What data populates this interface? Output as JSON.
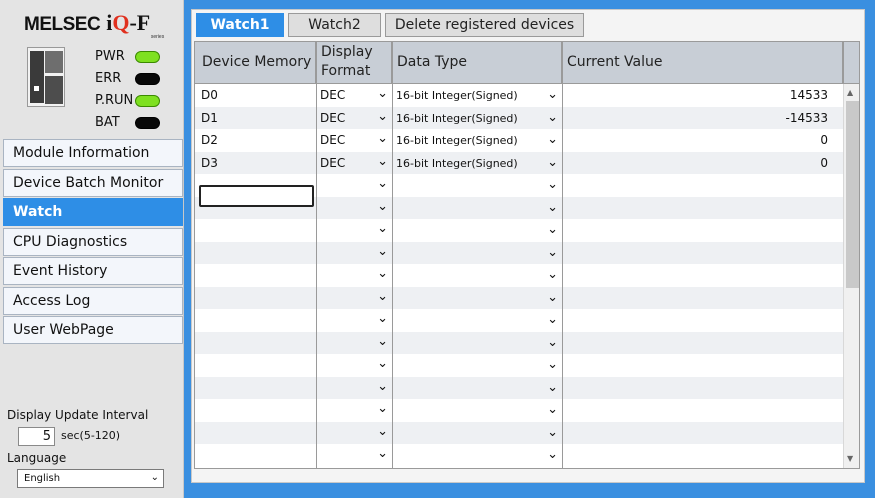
{
  "logo": {
    "brand": "MELSEC",
    "product_i": "i",
    "product_q": "Q",
    "product_dash": "-",
    "product_f": "F",
    "series": "series"
  },
  "status": [
    {
      "label": "PWR",
      "state": "on"
    },
    {
      "label": "ERR",
      "state": "off"
    },
    {
      "label": "P.RUN",
      "state": "on"
    },
    {
      "label": "BAT",
      "state": "off"
    }
  ],
  "colors": {
    "accent": "#2e8ee6",
    "led_on": "#7ee020",
    "led_off": "#080808",
    "background": "#3a8fe0"
  },
  "nav": {
    "items": [
      {
        "label": "Module Information",
        "active": false
      },
      {
        "label": "Device Batch Monitor",
        "active": false
      },
      {
        "label": "Watch",
        "active": true
      },
      {
        "label": "CPU Diagnostics",
        "active": false
      },
      {
        "label": "Event History",
        "active": false
      },
      {
        "label": "Access Log",
        "active": false
      },
      {
        "label": "User WebPage",
        "active": false
      }
    ]
  },
  "settings": {
    "interval_label": "Display Update Interval",
    "interval_value": "5",
    "interval_range": "sec(5-120)",
    "language_label": "Language",
    "language_value": "English"
  },
  "tabs": [
    {
      "label": "Watch1",
      "active": true
    },
    {
      "label": "Watch2",
      "active": false
    },
    {
      "label": "Delete registered devices",
      "active": false
    }
  ],
  "grid": {
    "headers": {
      "device": "Device Memory",
      "format_line1": "Display",
      "format_line2": "Format",
      "type": "Data Type",
      "value": "Current Value"
    },
    "rows": [
      {
        "device": "D0",
        "format": "DEC",
        "type": "16-bit Integer(Signed)",
        "value": "14533"
      },
      {
        "device": "D1",
        "format": "DEC",
        "type": "16-bit Integer(Signed)",
        "value": "-14533"
      },
      {
        "device": "D2",
        "format": "DEC",
        "type": "16-bit Integer(Signed)",
        "value": "0"
      },
      {
        "device": "D3",
        "format": "DEC",
        "type": "16-bit Integer(Signed)",
        "value": "0"
      }
    ],
    "empty_rows": 13
  },
  "icons": {
    "dropdown": "chevron-down-icon",
    "scroll_up": "scroll-up-arrow-icon",
    "scroll_down": "scroll-down-arrow-icon"
  }
}
